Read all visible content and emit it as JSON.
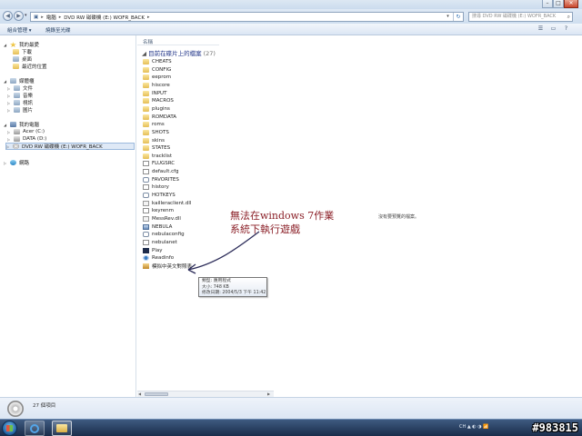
{
  "window": {
    "min_glyph": "–",
    "max_glyph": "□",
    "close_glyph": "✕"
  },
  "address": {
    "crumbs": [
      "電腦",
      "DVD RW 磁碟機 (E:) WOFR_BACK"
    ],
    "search_placeholder": "搜尋 DVD RW 磁碟機 (E:) WOFR_BACK"
  },
  "toolbar": {
    "organize": "組合管理 ▾",
    "burn": "燒錄至光碟"
  },
  "sidebar": {
    "favorites": "我的最愛",
    "fav_items": [
      "下載",
      "桌面",
      "最近的位置"
    ],
    "libraries": "媒體櫃",
    "lib_items": [
      "文件",
      "音樂",
      "視訊",
      "圖片"
    ],
    "computer": "我的電腦",
    "drives": [
      "Acer (C:)",
      "DATA (D:)",
      "DVD RW 磁碟機 (E:) WOFR_BACK"
    ],
    "network": "網路"
  },
  "filelist": {
    "column_name": "名稱",
    "group_label": "目前在碟片上的檔案",
    "group_count": "(27)",
    "items": [
      {
        "name": "CHEATS",
        "type": "folder"
      },
      {
        "name": "CONFIG",
        "type": "folder"
      },
      {
        "name": "eeprom",
        "type": "folder"
      },
      {
        "name": "hiscore",
        "type": "folder"
      },
      {
        "name": "INPUT",
        "type": "folder"
      },
      {
        "name": "MACROS",
        "type": "folder"
      },
      {
        "name": "plugins",
        "type": "folder"
      },
      {
        "name": "ROMDATA",
        "type": "folder"
      },
      {
        "name": "roms",
        "type": "folder"
      },
      {
        "name": "SHOTS",
        "type": "folder"
      },
      {
        "name": "skins",
        "type": "folder"
      },
      {
        "name": "STATES",
        "type": "folder"
      },
      {
        "name": "tracklist",
        "type": "folder"
      },
      {
        "name": "FLUGSRC",
        "type": "doc"
      },
      {
        "name": "default.cfg",
        "type": "doc"
      },
      {
        "name": "FAVORITES",
        "type": "gear"
      },
      {
        "name": "history",
        "type": "doc"
      },
      {
        "name": "HOTKEYS",
        "type": "gear"
      },
      {
        "name": "kailleraclient.dll",
        "type": "dll"
      },
      {
        "name": "keyrenm",
        "type": "doc"
      },
      {
        "name": "MessRev.dll",
        "type": "dll"
      },
      {
        "name": "NEBULA",
        "type": "app"
      },
      {
        "name": "nebulaconfig",
        "type": "gear"
      },
      {
        "name": "nebulanet",
        "type": "doc"
      },
      {
        "name": "Play",
        "type": "play"
      },
      {
        "name": "Readinfo",
        "type": "read"
      },
      {
        "name": "模拟中英文對照表",
        "type": "chm"
      }
    ]
  },
  "preview": {
    "text": "沒有要預覽的檔案。"
  },
  "tooltip": {
    "line1": "類型: 應用程式",
    "line2": "大小: 748 KB",
    "line3": "修改日期: 2004/5/3 下午 11:42"
  },
  "annotation": {
    "line1": "無法在windows 7作業",
    "line2": "系統下執行遊戲",
    "color": "#8a1e26"
  },
  "details": {
    "count": "27 個項目"
  },
  "taskbar": {
    "tray_text": "CH ▲ ◐ ◑ 📶",
    "watermark": "#983815"
  }
}
